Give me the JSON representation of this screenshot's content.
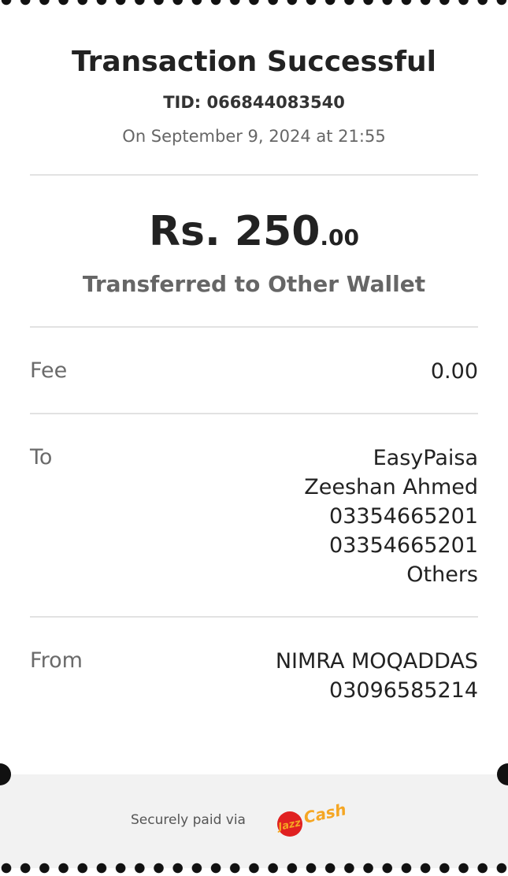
{
  "receipt": {
    "title": "Transaction Successful",
    "tid": "TID: 066844083540",
    "date": "On September 9, 2024 at 21:55",
    "amount_main": "Rs. 250",
    "amount_decimal": ".00",
    "subtitle": "Transferred to Other Wallet"
  },
  "fee": {
    "label": "Fee",
    "value": "0.00"
  },
  "to": {
    "label": "To",
    "lines": [
      "EasyPaisa",
      "Zeeshan Ahmed",
      "03354665201",
      "03354665201",
      "Others"
    ]
  },
  "from": {
    "label": "From",
    "lines": [
      "NIMRA MOQADDAS",
      "03096585214"
    ]
  },
  "footer": {
    "secure_text": "Securely paid via",
    "logo_text_1": "Jazz",
    "logo_text_2": "Cash",
    "logo_color_red": "#e02020",
    "logo_color_orange": "#f5a623"
  }
}
